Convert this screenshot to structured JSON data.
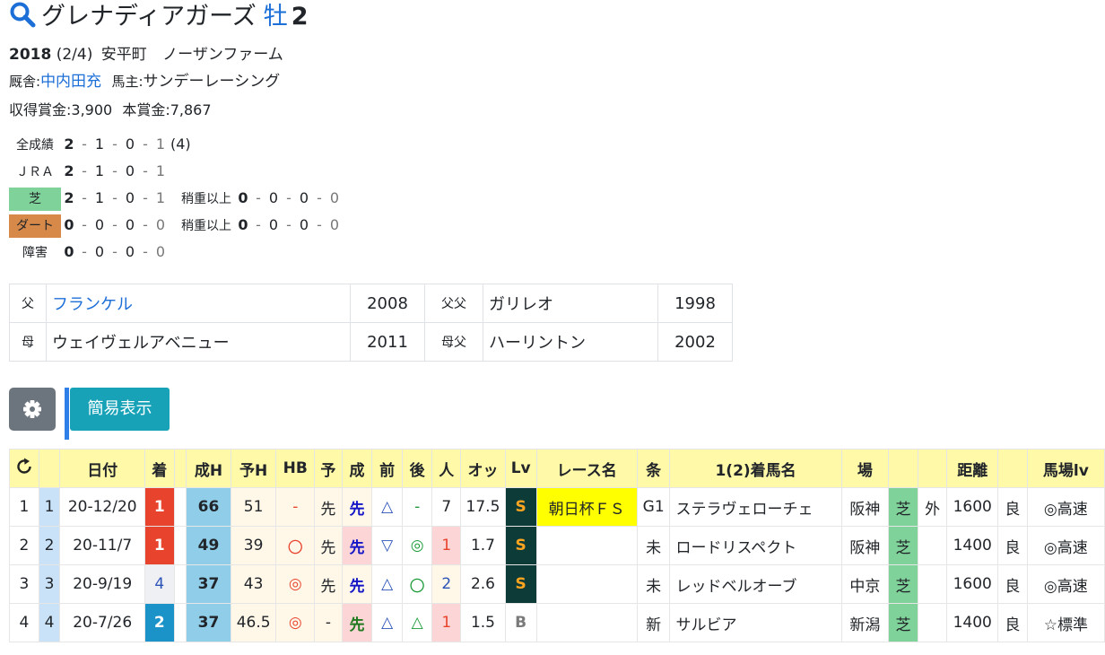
{
  "horse": {
    "name": "グレナディアガーズ",
    "sex": "牡",
    "age": "2"
  },
  "birth": {
    "year": "2018",
    "date": "(2/4)",
    "place": "安平町",
    "breeder": "ノーザンファーム"
  },
  "trainer": {
    "label": "厩舎:",
    "name": "中内田充"
  },
  "owner": {
    "label": "馬主:",
    "name": "サンデーレーシング"
  },
  "earnings": {
    "acquired_label": "収得賞金:",
    "acquired": "3,900",
    "prize_label": "本賞金:",
    "prize": "7,867"
  },
  "record": {
    "total": {
      "label": "全成績",
      "w": "2",
      "p": "1",
      "s": "0",
      "o": "1",
      "extra": "(4)"
    },
    "jra": {
      "label": "ＪＲＡ",
      "w": "2",
      "p": "1",
      "s": "0",
      "o": "1"
    },
    "turf": {
      "label": "芝",
      "w": "2",
      "p": "1",
      "s": "0",
      "o": "1",
      "heavy_label": "稍重以上",
      "hw": "0",
      "hp": "0",
      "hs": "0",
      "ho": "0"
    },
    "dirt": {
      "label": "ダート",
      "w": "0",
      "p": "0",
      "s": "0",
      "o": "0",
      "heavy_label": "稍重以上",
      "hw": "0",
      "hp": "0",
      "hs": "0",
      "ho": "0"
    },
    "jump": {
      "label": "障害",
      "w": "0",
      "p": "0",
      "s": "0",
      "o": "0"
    },
    "separator": "-"
  },
  "pedigree": {
    "sire_label": "父",
    "sire": "フランケル",
    "sire_year": "2008",
    "sire_sire_label": "父父",
    "sire_sire": "ガリレオ",
    "sire_sire_year": "1998",
    "dam_label": "母",
    "dam": "ウェイヴェルアベニュー",
    "dam_year": "2011",
    "dam_sire_label": "母父",
    "dam_sire": "ハーリントン",
    "dam_sire_year": "2002"
  },
  "buttons": {
    "settings_icon": "gear-icon",
    "simple_view": "簡易表示"
  },
  "colors": {
    "link": "#1d6fd8",
    "header_bg": "#fff9a8",
    "turf": "#7fd39a",
    "dirt": "#d7894a",
    "win": "#e8432c"
  },
  "table": {
    "headers": {
      "reload_icon": "reload-icon",
      "date": "日付",
      "finish": "着",
      "seiH": "成H",
      "yoH": "予H",
      "hb": "HB",
      "yo": "予",
      "sei": "成",
      "mae": "前",
      "ato": "後",
      "ninki": "人",
      "odds": "オッ",
      "lv": "Lv",
      "race": "レース名",
      "cond": "条",
      "winner": "1(2)着馬名",
      "course": "場",
      "dist": "距離",
      "baba": "馬場lv"
    },
    "rows": [
      {
        "no": "1",
        "run": "1",
        "date": "20-12/20",
        "finish": "1",
        "seiH": "66",
        "yoH": "51",
        "hb": "-",
        "yo": "先",
        "sei": "先",
        "mae": "△",
        "ato": "-",
        "ninki": "7",
        "odds": "17.5",
        "lv": "S",
        "race": "朝日杯ＦＳ",
        "cond": "G1",
        "winner": "ステラヴェローチェ",
        "course": "阪神",
        "surface": "芝",
        "inout": "外",
        "dist": "1600",
        "going": "良",
        "baba": "◎高速"
      },
      {
        "no": "2",
        "run": "2",
        "date": "20-11/7",
        "finish": "1",
        "seiH": "49",
        "yoH": "39",
        "hb": "〇",
        "yo": "先",
        "sei": "先",
        "mae": "▽",
        "ato": "◎",
        "ninki": "1",
        "odds": "1.7",
        "lv": "S",
        "race": "",
        "cond": "未",
        "winner": "ロードリスペクト",
        "course": "阪神",
        "surface": "芝",
        "inout": "",
        "dist": "1400",
        "going": "良",
        "baba": "◎高速"
      },
      {
        "no": "3",
        "run": "3",
        "date": "20-9/19",
        "finish": "4",
        "seiH": "37",
        "yoH": "43",
        "hb": "◎",
        "yo": "先",
        "sei": "先",
        "mae": "△",
        "ato": "〇",
        "ninki": "2",
        "odds": "2.6",
        "lv": "S",
        "race": "",
        "cond": "未",
        "winner": "レッドベルオーブ",
        "course": "中京",
        "surface": "芝",
        "inout": "",
        "dist": "1600",
        "going": "良",
        "baba": "◎高速"
      },
      {
        "no": "4",
        "run": "4",
        "date": "20-7/26",
        "finish": "2",
        "seiH": "37",
        "yoH": "46.5",
        "hb": "◎",
        "yo": "-",
        "sei": "先",
        "mae": "△",
        "ato": "△",
        "ninki": "1",
        "odds": "1.5",
        "lv": "B",
        "race": "",
        "cond": "新",
        "winner": "サルビア",
        "course": "新潟",
        "surface": "芝",
        "inout": "",
        "dist": "1400",
        "going": "良",
        "baba": "☆標準"
      }
    ]
  }
}
